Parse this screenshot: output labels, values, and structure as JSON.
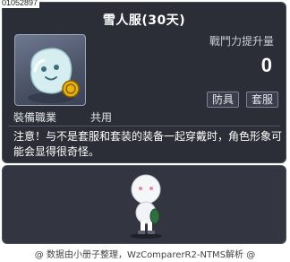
{
  "item": {
    "id": "01052897",
    "name": "雪人服(30天)",
    "stat_label": "戰鬥力提升量",
    "stat_value": "0",
    "tags": [
      "防具",
      "套服"
    ],
    "job_label": "裝備職業",
    "job_value": "共用",
    "note": "注意！与不是套服和套装的装备一起穿戴时，角色形象可能会显得很奇怪。"
  },
  "footer": "@ 数据由小册子整理，WzComparerR2-NTMS解析 @",
  "icons": {
    "item_icon": "snowman-suit-icon",
    "preview": "character-preview"
  },
  "colors": {
    "panel_bg": "#2b2e36",
    "stat_value": "#ffffff",
    "coin": "#e8b40a"
  }
}
